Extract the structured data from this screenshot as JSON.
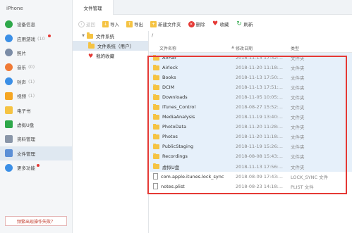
{
  "device": "iPhone",
  "sidebar": {
    "items": [
      {
        "label": "设备信息",
        "count": "",
        "icon": "info-icon",
        "color": "#2ea84a"
      },
      {
        "label": "应用游戏",
        "count": "(10",
        "icon": "app-store-icon",
        "color": "#3b8fe6",
        "dot": true
      },
      {
        "label": "照片",
        "count": "",
        "icon": "photos-icon",
        "color": "#7b8ca6"
      },
      {
        "label": "音乐",
        "count": "(0)",
        "icon": "music-icon",
        "color": "#f07a36"
      },
      {
        "label": "铃声",
        "count": "(1)",
        "icon": "bell-icon",
        "color": "#3b8fe6"
      },
      {
        "label": "视频",
        "count": "(1)",
        "icon": "video-icon",
        "color": "#f5a623"
      },
      {
        "label": "电子书",
        "count": "",
        "icon": "book-icon",
        "color": "#f5c343"
      },
      {
        "label": "虚拟U盘",
        "count": "",
        "icon": "usb-icon",
        "color": "#2ea84a"
      },
      {
        "label": "资料管理",
        "count": "",
        "icon": "document-icon",
        "color": "#8a96a8"
      },
      {
        "label": "文件管理",
        "count": "",
        "icon": "folder-icon",
        "color": "#5b8fd6",
        "active": true
      },
      {
        "label": "更多功能",
        "count": "",
        "icon": "grid-icon",
        "color": "#3b8fe6",
        "dot": true
      }
    ],
    "help": "频繁出现操作失败？"
  },
  "tab": "文件管理",
  "toolbar": {
    "back": "返回",
    "import": "导入",
    "export": "导出",
    "new_folder": "新建文件夹",
    "delete": "删除",
    "favorite": "收藏",
    "refresh": "刷新"
  },
  "tree": {
    "root": "文件系统",
    "child": "文件系统（用户）",
    "favorites": "我的收藏"
  },
  "path": "/",
  "list": {
    "headers": {
      "name": "文件名称",
      "date": "修改日期",
      "type": "类型"
    },
    "rows": [
      {
        "name": "AirFair",
        "date": "2018-11-13 17:32:...",
        "type": "文件夹",
        "kind": "folder"
      },
      {
        "name": "Airlock",
        "date": "2018-11-20 11:18:...",
        "type": "文件夹",
        "kind": "folder"
      },
      {
        "name": "Books",
        "date": "2018-11-13 17:50:...",
        "type": "文件夹",
        "kind": "folder"
      },
      {
        "name": "DCIM",
        "date": "2018-11-13 17:51:...",
        "type": "文件夹",
        "kind": "folder"
      },
      {
        "name": "Downloads",
        "date": "2018-11-05 10:05:...",
        "type": "文件夹",
        "kind": "folder"
      },
      {
        "name": "iTunes_Control",
        "date": "2018-08-27 15:52:...",
        "type": "文件夹",
        "kind": "folder"
      },
      {
        "name": "MediaAnalysis",
        "date": "2018-11-19 13:40:...",
        "type": "文件夹",
        "kind": "folder"
      },
      {
        "name": "PhotoData",
        "date": "2018-11-20 11:28:...",
        "type": "文件夹",
        "kind": "folder"
      },
      {
        "name": "Photos",
        "date": "2018-11-20 11:18:...",
        "type": "文件夹",
        "kind": "folder"
      },
      {
        "name": "PublicStaging",
        "date": "2018-11-19 15:26:...",
        "type": "文件夹",
        "kind": "folder"
      },
      {
        "name": "Recordings",
        "date": "2018-08-08 15:43:...",
        "type": "文件夹",
        "kind": "folder"
      },
      {
        "name": "虚拟U盘",
        "date": "2018-11-13 17:56:...",
        "type": "文件夹",
        "kind": "folder"
      },
      {
        "name": "com.apple.itunes.lock_sync",
        "date": "2018-08-09 17:43:...",
        "type": "LOCK_SYNC 文件",
        "kind": "file"
      },
      {
        "name": "notes.plist",
        "date": "2018-08-23 14:18:...",
        "type": "PLIST 文件",
        "kind": "file"
      }
    ]
  },
  "colors": {
    "highlight_frame": "#e53935",
    "selection": "#dfe8f1",
    "folder": "#f5c343"
  }
}
